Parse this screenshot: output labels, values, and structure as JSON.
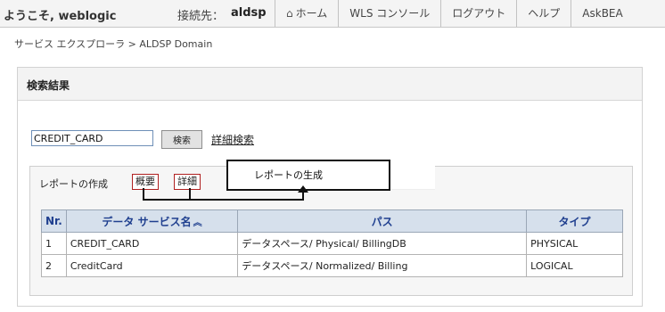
{
  "topbar": {
    "welcome": "ようこそ, weblogic",
    "connection_label": "接続先：",
    "connection_value": "aldsp",
    "nav": [
      {
        "label": "ホーム",
        "icon": "home-icon"
      },
      {
        "label": "WLS コンソール"
      },
      {
        "label": "ログアウト"
      },
      {
        "label": "ヘルプ"
      },
      {
        "label": "AskBEA"
      }
    ]
  },
  "breadcrumb": "サービス エクスプローラ > ALDSP Domain",
  "panel": {
    "title": "検索結果",
    "search": {
      "value": "CREDIT_CARD",
      "button_label": "検索",
      "advanced_link": "詳細検索"
    },
    "report": {
      "label": "レポートの作成",
      "summary_label": "概要",
      "detail_label": "詳細"
    },
    "table": {
      "headers": {
        "nr": "Nr.",
        "name": "データ サービス名",
        "path": "パス",
        "type": "タイプ"
      },
      "sort_icon": "sort-ascending-icon",
      "rows": [
        {
          "nr": "1",
          "name": "CREDIT_CARD",
          "path": "データスペース/ Physical/ BillingDB",
          "type": "PHYSICAL"
        },
        {
          "nr": "2",
          "name": "CreditCard",
          "path": "データスペース/ Normalized/ Billing",
          "type": "LOGICAL"
        }
      ]
    }
  },
  "annotation": {
    "callout_text": "レポートの生成"
  },
  "colors": {
    "header_bg": "#d6e0ec",
    "header_text": "#1f3f8f",
    "tag_border": "#b02020",
    "topbar_bg": "#f4f4f4"
  }
}
